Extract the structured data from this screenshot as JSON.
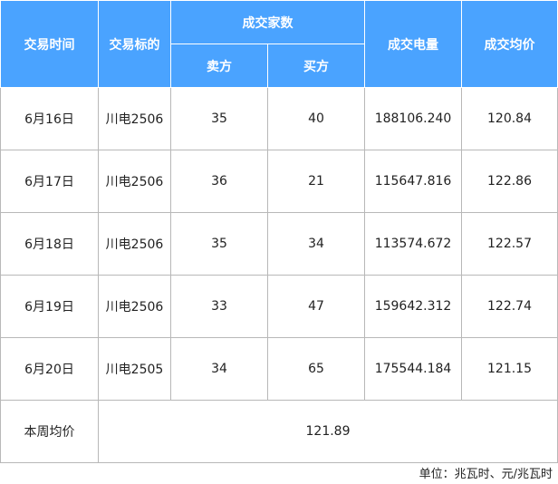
{
  "table": {
    "headers": {
      "date": "交易时间",
      "target": "交易标的",
      "parties_group": "成交家数",
      "seller": "卖方",
      "buyer": "买方",
      "volume": "成交电量",
      "avg_price": "成交均价"
    },
    "rows": [
      {
        "date": "6月16日",
        "target": "川电2506",
        "seller": "35",
        "buyer": "40",
        "volume": "188106.240",
        "price": "120.84"
      },
      {
        "date": "6月17日",
        "target": "川电2506",
        "seller": "36",
        "buyer": "21",
        "volume": "115647.816",
        "price": "122.86"
      },
      {
        "date": "6月18日",
        "target": "川电2506",
        "seller": "35",
        "buyer": "34",
        "volume": "113574.672",
        "price": "122.57"
      },
      {
        "date": "6月19日",
        "target": "川电2506",
        "seller": "33",
        "buyer": "47",
        "volume": "159642.312",
        "price": "122.74"
      },
      {
        "date": "6月20日",
        "target": "川电2505",
        "seller": "34",
        "buyer": "65",
        "volume": "175544.184",
        "price": "121.15"
      }
    ],
    "summary": {
      "label": "本周均价",
      "value": "121.89"
    }
  },
  "unit_note": "单位：兆瓦时、元/兆瓦时",
  "colors": {
    "header_bg": "#4aa3ff",
    "header_text": "#ffffff",
    "border": "#b8b8b8"
  }
}
